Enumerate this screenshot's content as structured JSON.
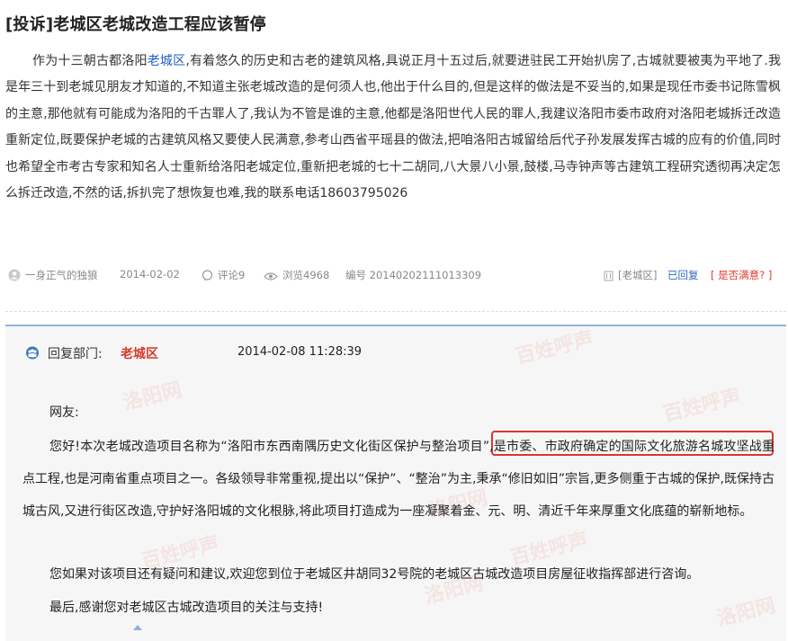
{
  "post": {
    "title": "[投诉]老城区老城改造工程应该暂停",
    "body_before_link": "作为十三朝古都洛阳",
    "body_link": "老城区",
    "body_after_link": ",有着悠久的历史和古老的建筑风格,具说正月十五过后,就要进驻民工开始扒房了,古城就要被夷为平地了.我是年三十到老城见朋友才知道的,不知道主张老城改造的是何须人也,他出于什么目的,但是这样的做法是不妥当的,如果是现任市委书记陈雪枫的主意,那他就有可能成为洛阳的千古罪人了,我认为不管是谁的主意,他都是洛阳世代人民的罪人,我建议洛阳市委市政府对洛阳老城拆迁改造重新定位,既要保护老城的古建筑风格又要使人民满意,参考山西省平瑶县的做法,把咱洛阳古城留给后代子孙发展发挥古城的应有的价值,同时也希望全市考古专家和知名人士重新给洛阳老城定位,重新把老城的七十二胡同,八大景八小景,鼓楼,马寺钟声等古建筑工程研究透彻再决定怎么拆迁改造,不然的话,拆扒完了想恢复也难,我的联系电话18603795026"
  },
  "meta": {
    "author": "一身正气的独狼",
    "date": "2014-02-02",
    "comments": "评论9",
    "views": "浏览4968",
    "serial": "编号 20140202111013309",
    "tag": "[老城区]",
    "status": "已回复",
    "satisfaction": "[ 是否满意? ]"
  },
  "reply": {
    "dept_label": "回复部门:",
    "dept_name": "老城区",
    "time": "2014-02-08 11:28:39",
    "greeting": "网友:",
    "p1_a": "您好!本次老城改造项目名称为“洛阳市东西南隅历史文化街区保护与整治项目”",
    "p1_b": ",是市委、市政府确定的国际文化旅游名城攻坚战重",
    "p1_c": "点工程,也是河南省重点项目之一。各级领导非常重视,提出以“保护”、“整治”为主,秉承“修旧如旧”宗旨,更多侧重于古城的保护,既保持古城古风,又进行街区改造,守护好洛阳城的文化根脉,将此项目打造成为一座凝聚着金、元、明、清近千年来厚重文化底蕴的崭新地标。",
    "p2": "您如果对该项目还有疑问和建议,欢迎您到位于老城区井胡同32号院的老城区古城改造项目房屋征收指挥部进行咨询。",
    "p3": "最后,感谢您对老城区古城改造项目的关注与支持!"
  },
  "watermarks": {
    "w1": "洛阳网",
    "w2": "百姓呼声"
  },
  "colors": {
    "link": "#1f5fbf",
    "reply_dept": "#d23a2e",
    "highlight": "#d9362e",
    "panel_border": "#8fb2dc",
    "panel_bg": "#f6f6f6"
  },
  "icons": {
    "author": "user-avatar-icon",
    "comments": "comment-bubble-icon",
    "views": "eye-icon",
    "tag": "building-icon",
    "dept": "people-group-icon"
  }
}
